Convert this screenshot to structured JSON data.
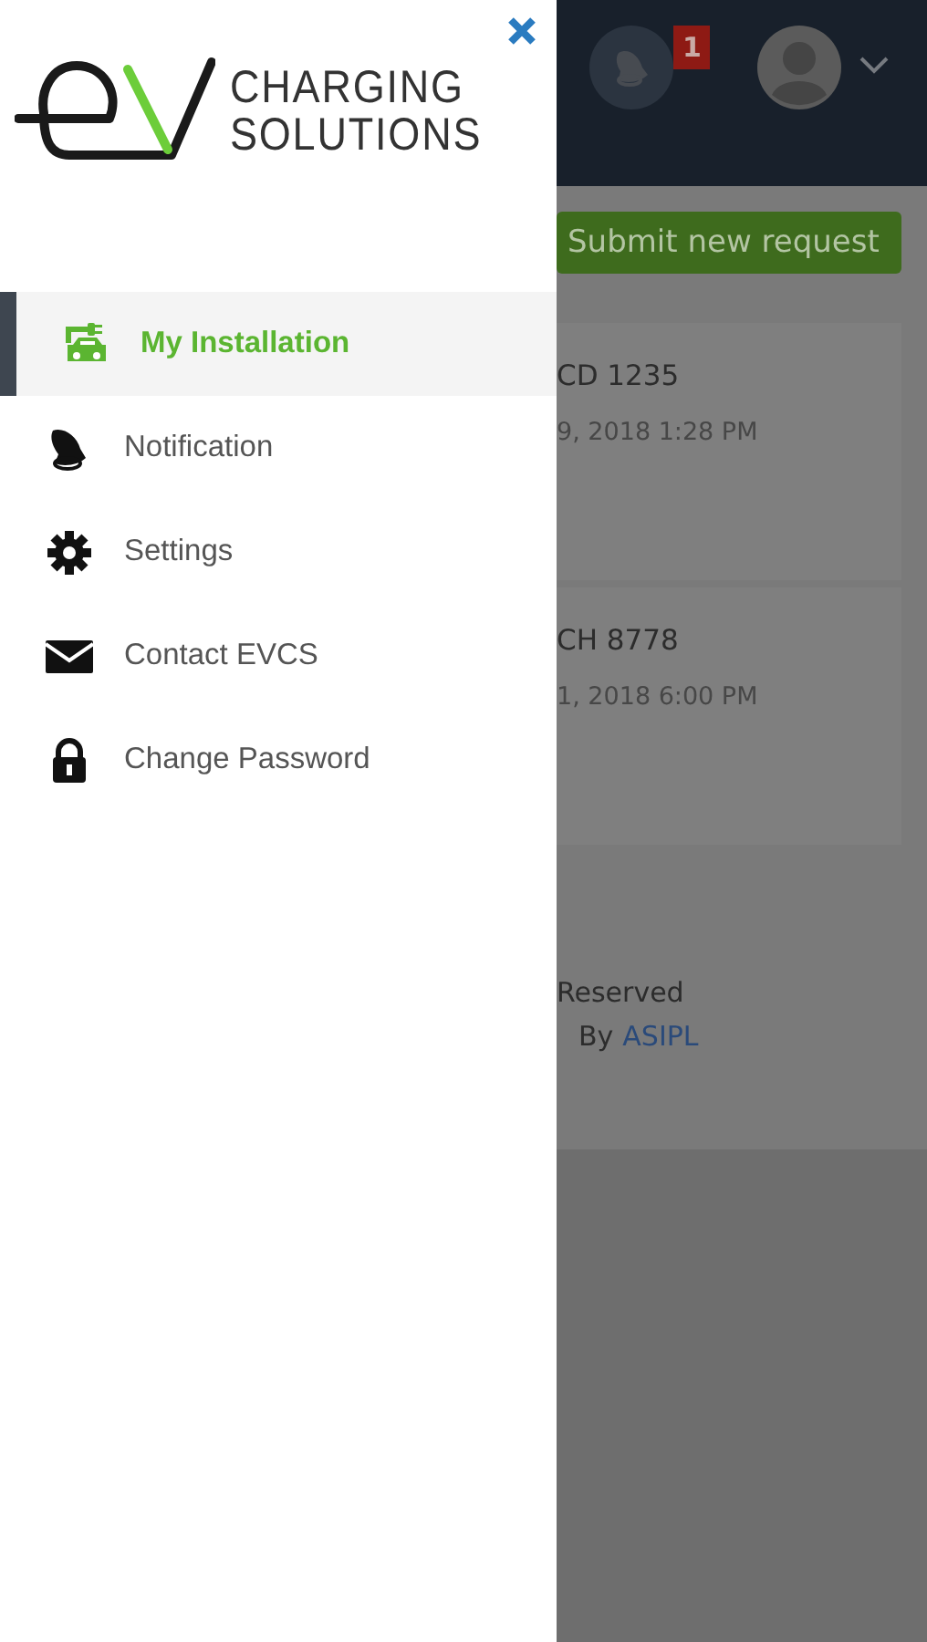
{
  "drawer": {
    "logo": {
      "line1": "CHARGING",
      "line2": "SOLUTIONS"
    },
    "menu": [
      {
        "label": "My Installation",
        "selected": true
      },
      {
        "label": "Notification",
        "selected": false
      },
      {
        "label": "Settings",
        "selected": false
      },
      {
        "label": "Contact EVCS",
        "selected": false
      },
      {
        "label": "Change Password",
        "selected": false
      }
    ]
  },
  "header": {
    "notification_count": "1"
  },
  "submit_button": "Submit new request",
  "cards": [
    {
      "title": "CD 1235",
      "date": "9, 2018 1:28 PM"
    },
    {
      "title": "CH 8778",
      "date": "1, 2018 6:00 PM"
    }
  ],
  "footer": {
    "line1": "Reserved",
    "by": "By",
    "link": "ASIPL"
  }
}
